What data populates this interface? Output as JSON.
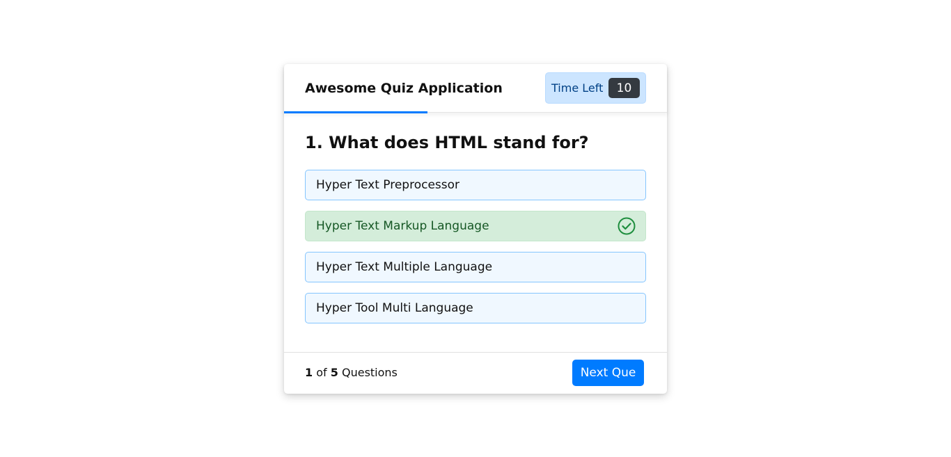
{
  "header": {
    "title": "Awesome Quiz Application",
    "timer": {
      "label": "Time Left",
      "seconds": "10"
    },
    "time_line_progress": 0.375
  },
  "question": {
    "text": "1. What does HTML stand for?"
  },
  "options": [
    {
      "label": "Hyper Text Preprocessor",
      "state": "default"
    },
    {
      "label": "Hyper Text Markup Language",
      "state": "correct",
      "icon": "check-circle-icon"
    },
    {
      "label": "Hyper Text Multiple Language",
      "state": "default"
    },
    {
      "label": "Hyper Tool Multi Language",
      "state": "default"
    }
  ],
  "footer": {
    "current": "1",
    "of_text": "of",
    "total": "5",
    "questions_text": "Questions",
    "next_button": "Next Que"
  },
  "colors": {
    "accent": "#007bff",
    "correct_bg": "#d4edda",
    "correct_text": "#155724",
    "option_bg": "#f0f8ff",
    "option_border": "#84c5fe",
    "timer_bg": "#cce5ff",
    "timer_badge_bg": "#343a40"
  }
}
